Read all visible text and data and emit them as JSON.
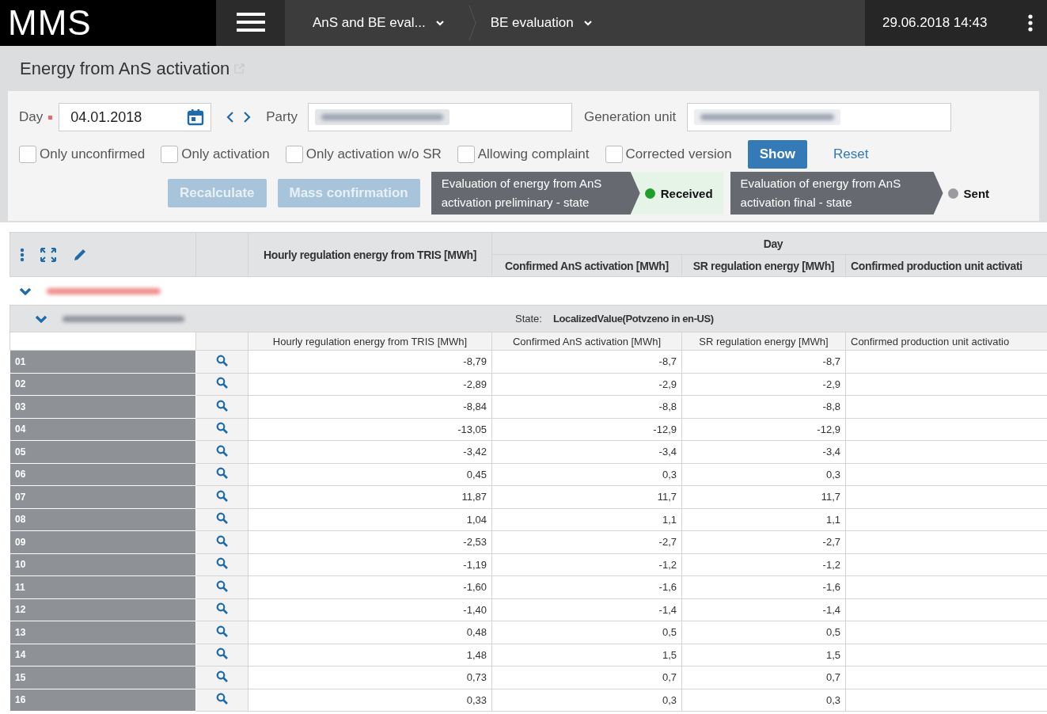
{
  "app": {
    "logo": "MMS",
    "breadcrumbs": [
      {
        "label": "AnS and BE eval..."
      },
      {
        "label": "BE evaluation"
      }
    ],
    "datetime": "29.06.2018 14:43"
  },
  "page": {
    "title": "Energy from AnS activation"
  },
  "filters": {
    "day": {
      "label": "Day",
      "required": true,
      "value": "04.01.2018"
    },
    "party": {
      "label": "Party"
    },
    "generation_unit": {
      "label": "Generation unit"
    },
    "checkboxes": [
      {
        "label": "Only unconfirmed",
        "checked": false
      },
      {
        "label": "Only activation",
        "checked": false
      },
      {
        "label": "Only activation w/o SR",
        "checked": false
      },
      {
        "label": "Allowing complaint",
        "checked": false
      },
      {
        "label": "Corrected version",
        "checked": false
      }
    ],
    "buttons": [
      {
        "label": "Show",
        "kind": "primary"
      },
      {
        "label": "Reset",
        "kind": "link"
      }
    ],
    "actions": [
      {
        "label": "Recalculate",
        "disabled": true
      },
      {
        "label": "Mass confirmation",
        "disabled": true
      }
    ],
    "states": [
      {
        "label": "Evaluation of energy from AnS activation preliminary - state",
        "status": "Received",
        "color": "#1e9e2a"
      },
      {
        "label": "Evaluation of energy from AnS activation final - state",
        "status": "Sent",
        "color": "#9a9b9e"
      }
    ]
  },
  "table": {
    "first_column": "Hourly regulation energy from TRIS [MWh]",
    "group_header": "Day",
    "columns": [
      "Confirmed AnS activation [MWh]",
      "SR regulation energy [MWh]",
      "Confirmed production unit activati"
    ],
    "groups": [
      {
        "expanded": true
      },
      {
        "expanded": true,
        "state_label": "State:",
        "state": "LocalizedValue(Potvzeno in en-US)"
      }
    ],
    "subcolumns": [
      "Hourly regulation energy from TRIS [MWh]",
      "Confirmed AnS activation [MWh]",
      "SR regulation energy [MWh]",
      "Confirmed production unit activatio"
    ],
    "rows": [
      {
        "hour": "01",
        "values": [
          "-8,79",
          "-8,7",
          "-8,7"
        ]
      },
      {
        "hour": "02",
        "values": [
          "-2,89",
          "-2,9",
          "-2,9"
        ]
      },
      {
        "hour": "03",
        "values": [
          "-8,84",
          "-8,8",
          "-8,8"
        ]
      },
      {
        "hour": "04",
        "values": [
          "-13,05",
          "-12,9",
          "-12,9"
        ]
      },
      {
        "hour": "05",
        "values": [
          "-3,42",
          "-3,4",
          "-3,4"
        ]
      },
      {
        "hour": "06",
        "values": [
          "0,45",
          "0,3",
          "0,3"
        ]
      },
      {
        "hour": "07",
        "values": [
          "11,87",
          "11,7",
          "11,7"
        ]
      },
      {
        "hour": "08",
        "values": [
          "1,04",
          "1,1",
          "1,1"
        ]
      },
      {
        "hour": "09",
        "values": [
          "-2,53",
          "-2,7",
          "-2,7"
        ]
      },
      {
        "hour": "10",
        "values": [
          "-1,19",
          "-1,2",
          "-1,2"
        ]
      },
      {
        "hour": "11",
        "values": [
          "-1,60",
          "-1,6",
          "-1,6"
        ]
      },
      {
        "hour": "12",
        "values": [
          "-1,40",
          "-1,4",
          "-1,4"
        ]
      },
      {
        "hour": "13",
        "values": [
          "0,48",
          "0,5",
          "0,5"
        ]
      },
      {
        "hour": "14",
        "values": [
          "1,48",
          "1,5",
          "1,5"
        ]
      },
      {
        "hour": "15",
        "values": [
          "0,73",
          "0,7",
          "0,7"
        ]
      },
      {
        "hour": "16",
        "values": [
          "0,33",
          "0,3",
          "0,3"
        ]
      }
    ]
  }
}
